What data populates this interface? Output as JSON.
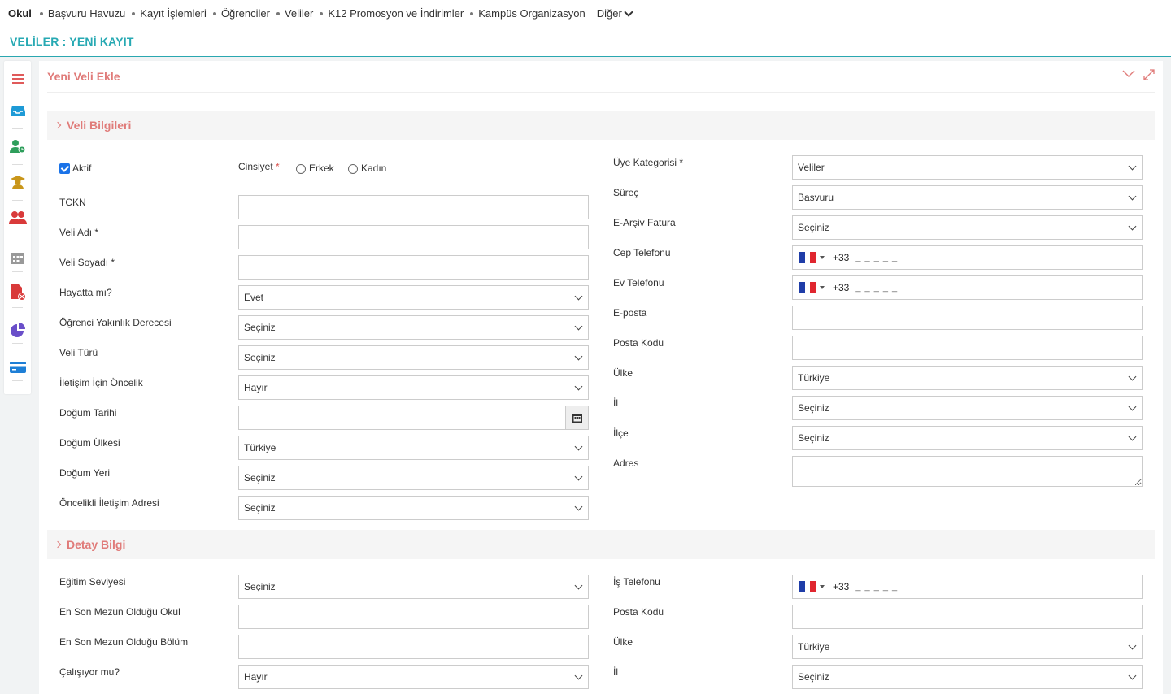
{
  "topnav": {
    "items": [
      "Okul",
      "Başvuru Havuzu",
      "Kayıt İşlemleri",
      "Öğrenciler",
      "Veliler",
      "K12 Promosyon ve İndirimler",
      "Kampüs Organizasyon",
      "Diğer"
    ]
  },
  "page": {
    "title": "VELİLER : YENİ KAYIT"
  },
  "sidebar": {
    "icons": [
      "menu-icon",
      "inbox-icon",
      "user-clock-icon",
      "graduate-icon",
      "users-icon",
      "calendar-icon",
      "pdf-remove-icon",
      "pie-chart-icon",
      "card-icon"
    ]
  },
  "panel": {
    "title": "Yeni Veli Ekle"
  },
  "veli": {
    "section_title": "Veli Bilgileri",
    "aktif_label": "Aktif",
    "cinsiyet_label": "Cinsiyet",
    "req": "*",
    "erkek": "Erkek",
    "kadin": "Kadın",
    "tckn": "TCKN",
    "adi": "Veli Adı *",
    "soyadi": "Veli Soyadı *",
    "hayatta_label": "Hayatta mı?",
    "hayatta_value": "Evet",
    "yakinlik_label": "Öğrenci Yakınlık Derecesi",
    "yakinlik_value": "Seçiniz",
    "veli_turu_label": "Veli Türü",
    "veli_turu_value": "Seçiniz",
    "oncelik_label": "İletişim İçin Öncelik",
    "oncelik_value": "Hayır",
    "dogum_tarihi": "Doğum Tarihi",
    "dogum_ulkesi_label": "Doğum Ülkesi",
    "dogum_ulkesi_value": "Türkiye",
    "dogum_yeri_label": "Doğum Yeri",
    "dogum_yeri_value": "Seçiniz",
    "oncelikli_adres_label": "Öncelikli İletişim Adresi",
    "oncelikli_adres_value": "Seçiniz",
    "uye_kategori_label": "Üye Kategorisi *",
    "uye_kategori_value": "Veliler",
    "surec_label": "Süreç",
    "surec_value": "Basvuru",
    "earsiv_label": "E-Arşiv Fatura",
    "earsiv_value": "Seçiniz",
    "cep_label": "Cep Telefonu",
    "ev_label": "Ev Telefonu",
    "phone_code": "+33",
    "phone_mask": "_ _ _ _ _",
    "eposta": "E-posta",
    "posta_kodu": "Posta Kodu",
    "ulke_label": "Ülke",
    "ulke_value": "Türkiye",
    "il_label": "İl",
    "il_value": "Seçiniz",
    "ilce_label": "İlçe",
    "ilce_value": "Seçiniz",
    "adres": "Adres"
  },
  "detay": {
    "section_title": "Detay Bilgi",
    "egitim_label": "Eğitim Seviyesi",
    "egitim_value": "Seçiniz",
    "okul": "En Son Mezun Olduğu Okul",
    "bolum": "En Son Mezun Olduğu Bölüm",
    "calisiyor_label": "Çalışıyor mu?",
    "calisiyor_value": "Hayır",
    "is_tel_label": "İş Telefonu",
    "posta_kodu": "Posta Kodu",
    "ulke_label": "Ülke",
    "ulke_value": "Türkiye",
    "il_label": "İl",
    "il_value": "Seçiniz"
  },
  "colors": {
    "accent_teal": "#27a9b3",
    "accent_coral": "#e07b79",
    "checkbox_blue": "#1a73e8"
  }
}
